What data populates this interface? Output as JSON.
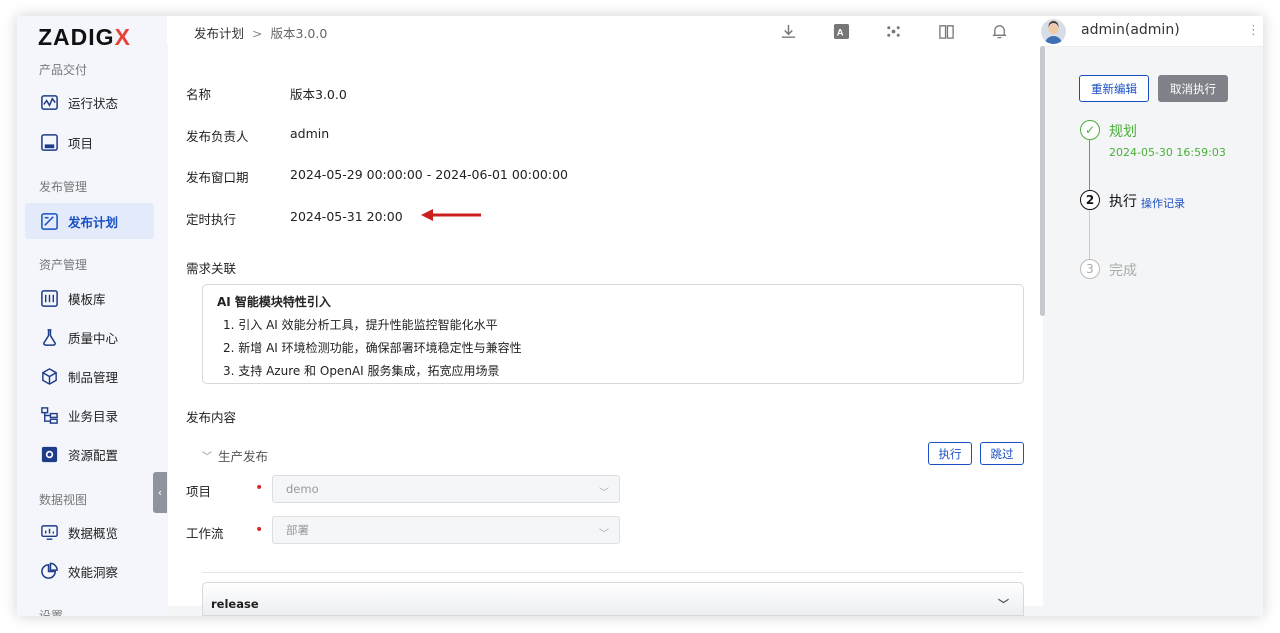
{
  "brand": {
    "name_main": "ZADIG",
    "name_accent": "X"
  },
  "sidebar": {
    "sections": [
      {
        "title": "产品交付"
      },
      {
        "title": "发布管理"
      },
      {
        "title": "资产管理"
      },
      {
        "title": "数据视图"
      },
      {
        "title": "设置"
      }
    ],
    "items": [
      {
        "label": "运行状态",
        "icon": "pulse-icon"
      },
      {
        "label": "项目",
        "icon": "project-icon"
      },
      {
        "label": "发布计划",
        "icon": "release-plan-icon",
        "active": true
      },
      {
        "label": "模板库",
        "icon": "template-icon"
      },
      {
        "label": "质量中心",
        "icon": "flask-icon"
      },
      {
        "label": "制品管理",
        "icon": "box-icon"
      },
      {
        "label": "业务目录",
        "icon": "catalog-icon"
      },
      {
        "label": "资源配置",
        "icon": "gear-box-icon"
      },
      {
        "label": "数据概览",
        "icon": "dashboard-icon"
      },
      {
        "label": "效能洞察",
        "icon": "pie-icon"
      }
    ]
  },
  "header": {
    "breadcrumb": {
      "parent": "发布计划",
      "separator": ">",
      "current": "版本3.0.0"
    },
    "icons": [
      "download-icon",
      "translate-icon",
      "plugin-icon",
      "docs-icon",
      "bell-icon"
    ],
    "user": "admin(admin)"
  },
  "form": {
    "name_label": "名称",
    "name_value": "版本3.0.0",
    "owner_label": "发布负责人",
    "owner_value": "admin",
    "window_label": "发布窗口期",
    "window_value": "2024-05-29 00:00:00 - 2024-06-01 00:00:00",
    "schedule_label": "定时执行",
    "schedule_value": "2024-05-31 20:00"
  },
  "requirements": {
    "section_label": "需求关联",
    "title": "AI 智能模块特性引入",
    "items": [
      "1. 引入 AI 效能分析工具，提升性能监控智能化水平",
      "2. 新增 AI 环境检测功能，确保部署环境稳定性与兼容性",
      "3. 支持 Azure 和 OpenAI 服务集成，拓宽应用场景"
    ]
  },
  "content": {
    "section_label": "发布内容",
    "group_title": "生产发布",
    "execute_label": "执行",
    "skip_label": "跳过",
    "project_label": "项目",
    "project_value": "demo",
    "workflow_label": "工作流",
    "workflow_value": "部署",
    "release_label": "release"
  },
  "actions": {
    "edit_label": "重新编辑",
    "cancel_label": "取消执行"
  },
  "steps": [
    {
      "num": "✓",
      "label": "规划",
      "sub": "2024-05-30 16:59:03",
      "state": "done"
    },
    {
      "num": "2",
      "label": "执行",
      "link": "操作记录",
      "state": "current"
    },
    {
      "num": "3",
      "label": "完成",
      "state": "pending"
    }
  ],
  "colors": {
    "accent": "#1a4fc4",
    "done": "#4caf3b",
    "arrow": "#cc1f1f"
  }
}
